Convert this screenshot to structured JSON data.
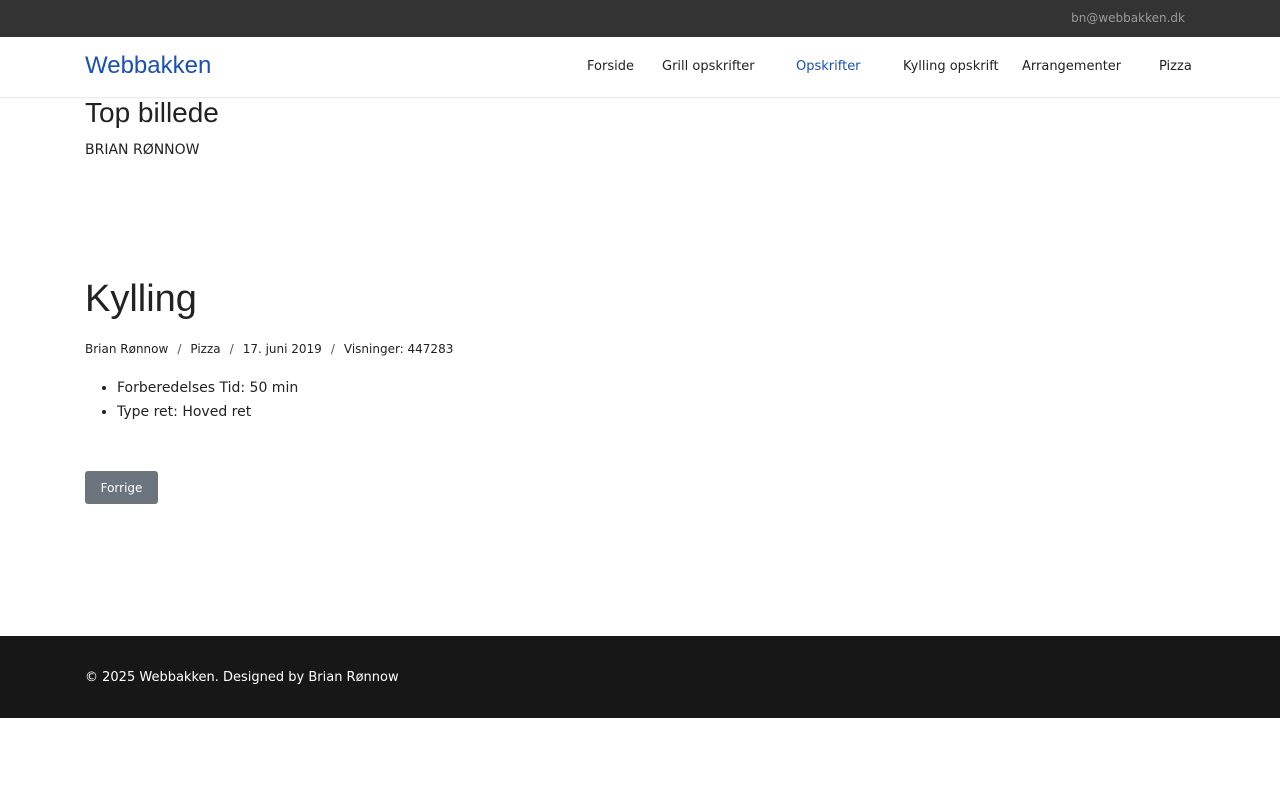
{
  "topbar": {
    "email": "bn@webbakken.dk"
  },
  "navbar": {
    "brand": "Webbakken",
    "items": [
      {
        "label": "Forside"
      },
      {
        "label": "Grill opskrifter"
      },
      {
        "label": "Opskrifter",
        "active": true
      },
      {
        "label": "Kylling opskrift"
      },
      {
        "label": "Arrangementer"
      },
      {
        "label": "Pizza"
      }
    ]
  },
  "hero": {
    "title": "Top billede",
    "author": "BRIAN RØNNOW"
  },
  "post": {
    "title": "Kylling",
    "meta": {
      "author": "Brian Rønnow",
      "category": "Pizza",
      "date": "17. juni 2019",
      "views_label": "Visninger: 447283",
      "separator": "/"
    },
    "facts": [
      "Forberedelses Tid: 50 min",
      "Type ret: Hoved ret"
    ],
    "prev_label": "Forrige"
  },
  "footer": {
    "text": "© 2025 Webbakken. Designed by Brian Rønnow"
  },
  "colors": {
    "brand": "#1a4fb5",
    "topbar_bg": "#333333",
    "footer_bg": "#171717",
    "button_bg": "#6c757d"
  }
}
